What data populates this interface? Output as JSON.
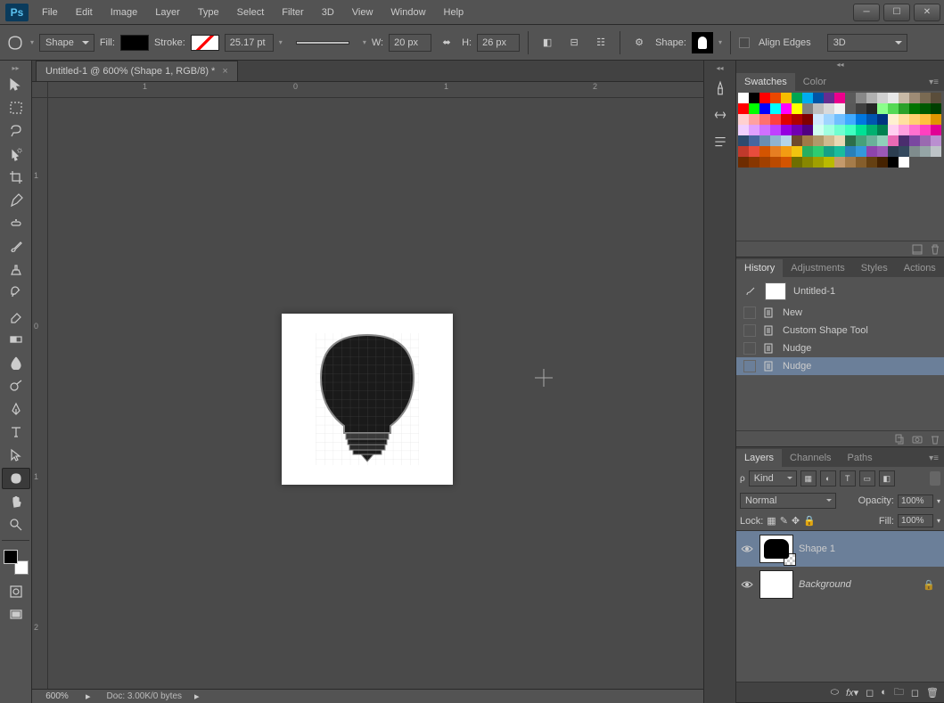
{
  "app": {
    "logo": "Ps"
  },
  "menu": [
    "File",
    "Edit",
    "Image",
    "Layer",
    "Type",
    "Select",
    "Filter",
    "3D",
    "View",
    "Window",
    "Help"
  ],
  "options": {
    "mode": "Shape",
    "fill_label": "Fill:",
    "stroke_label": "Stroke:",
    "stroke_width": "25.17 pt",
    "w_label": "W:",
    "w_value": "20 px",
    "h_label": "H:",
    "h_value": "26 px",
    "shape_label": "Shape:",
    "align_edges": "Align Edges",
    "workspace": "3D"
  },
  "document": {
    "tab_title": "Untitled-1 @ 600% (Shape 1, RGB/8) *",
    "zoom": "600%",
    "status": "Doc: 3.00K/0 bytes",
    "ruler_h": [
      {
        "pos": 106,
        "v": "1"
      },
      {
        "pos": 275,
        "v": "0"
      },
      {
        "pos": 444,
        "v": "1"
      },
      {
        "pos": 611,
        "v": "2"
      }
    ],
    "ruler_v": [
      {
        "pos": 82,
        "v": "1"
      },
      {
        "pos": 251,
        "v": "0"
      },
      {
        "pos": 420,
        "v": "1"
      },
      {
        "pos": 589,
        "v": "2"
      }
    ]
  },
  "swatches": {
    "tab": "Swatches",
    "tab2": "Color"
  },
  "swatch_colors": [
    "#fff",
    "#000",
    "#f00",
    "#ea4700",
    "#f6be00",
    "#00a651",
    "#00adef",
    "#0054a6",
    "#652d90",
    "#ec008c",
    "#5b5b5b",
    "#888",
    "#b0b0b0",
    "#d0d0d0",
    "#e8e8e8",
    "#c8b9a6",
    "#9e8b75",
    "#7a6a52",
    "#5a4d3a",
    "#f00",
    "#0f0",
    "#00f",
    "#0ff",
    "#f0f",
    "#ff0",
    "#808080",
    "#bfbfbf",
    "#d9d9d9",
    "#f2f2f2",
    "#595959",
    "#404040",
    "#262626",
    "#8cff8c",
    "#55d955",
    "#2aa12a",
    "#007300",
    "#005900",
    "#003f00",
    "#ffd0d0",
    "#ffa0a0",
    "#ff7070",
    "#ff4040",
    "#e00000",
    "#b00000",
    "#800000",
    "#d0eaff",
    "#a0d5ff",
    "#70bfff",
    "#40aaff",
    "#0077e0",
    "#0055b0",
    "#003380",
    "#fff0d0",
    "#ffe0a0",
    "#ffd070",
    "#ffc040",
    "#e09500",
    "#f0d0ff",
    "#e0a0ff",
    "#d070ff",
    "#c040ff",
    "#9500e0",
    "#7000b0",
    "#500080",
    "#d0fff0",
    "#a0ffe0",
    "#70ffd0",
    "#40ffc0",
    "#00e095",
    "#00b070",
    "#008050",
    "#ffd0f0",
    "#ffa0e0",
    "#ff70d0",
    "#ff40c0",
    "#e00095",
    "#2d4a6e",
    "#4766a0",
    "#6a8fb0",
    "#8fb4d0",
    "#b4d5e8",
    "#6e4a2d",
    "#a07a47",
    "#b09a6a",
    "#d0ba8f",
    "#e8d8b4",
    "#2d6e4a",
    "#47a07a",
    "#6ab09a",
    "#8fd0ba",
    "#e86ab4",
    "#4a2d6e",
    "#7a47a0",
    "#9a6ab0",
    "#ba8fd0",
    "#c0392b",
    "#e74c3c",
    "#d35400",
    "#e67e22",
    "#f39c12",
    "#f1c40f",
    "#27ae60",
    "#2ecc71",
    "#16a085",
    "#1abc9c",
    "#2980b9",
    "#3498db",
    "#8e44ad",
    "#9b59b6",
    "#2c3e50",
    "#34495e",
    "#7f8c8d",
    "#95a5a6",
    "#bdc3c7",
    "#6e2c00",
    "#873600",
    "#a04000",
    "#ba4a00",
    "#d35400",
    "#6e6e00",
    "#878700",
    "#a0a000",
    "#baba00",
    "#c49a6c",
    "#a57c4a",
    "#855e2c",
    "#654012",
    "#452200",
    "#000",
    "#fff",
    "",
    "",
    ""
  ],
  "history": {
    "tab": "History",
    "tab2": "Adjustments",
    "tab3": "Styles",
    "tab4": "Actions",
    "snapshot": "Untitled-1",
    "items": [
      "New",
      "Custom Shape Tool",
      "Nudge",
      "Nudge"
    ],
    "selected": 3
  },
  "layers": {
    "tab": "Layers",
    "tab2": "Channels",
    "tab3": "Paths",
    "kind": "Kind",
    "blend": "Normal",
    "opacity_label": "Opacity:",
    "opacity": "100%",
    "lock_label": "Lock:",
    "fill_label": "Fill:",
    "fill": "100%",
    "items": [
      {
        "name": "Shape 1",
        "type": "shape",
        "selected": true
      },
      {
        "name": "Background",
        "type": "bg",
        "locked": true
      }
    ]
  }
}
